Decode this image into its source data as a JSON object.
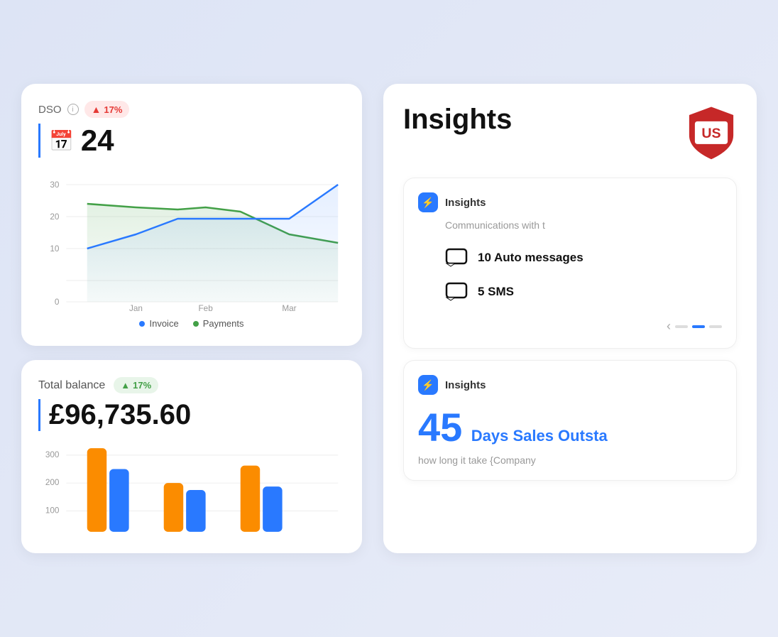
{
  "left": {
    "dso": {
      "label": "DSO",
      "badge": "17%",
      "value": "24",
      "chart": {
        "yLabels": [
          "30",
          "20",
          "10",
          "0"
        ],
        "xLabels": [
          "Jan",
          "Feb",
          "Mar"
        ],
        "legend": [
          {
            "label": "Invoice",
            "color": "#2979ff"
          },
          {
            "label": "Payments",
            "color": "#43a047"
          }
        ]
      }
    },
    "balance": {
      "label": "Total balance",
      "badge": "17%",
      "value": "£96,735.60",
      "yLabels": [
        "300",
        "200",
        "100"
      ]
    }
  },
  "right": {
    "title": "Insights",
    "logo_text": "US",
    "cards": [
      {
        "badge_icon": "⚡",
        "title": "Insights",
        "subtitle": "Communications with t",
        "stats": [
          {
            "count": "10 Auto messages"
          },
          {
            "count": "5 SMS"
          }
        ]
      },
      {
        "badge_icon": "⚡",
        "title": "Insights",
        "big_number": "45",
        "big_label": "Days Sales Outsta",
        "description": "how long it take {Company"
      }
    ]
  }
}
